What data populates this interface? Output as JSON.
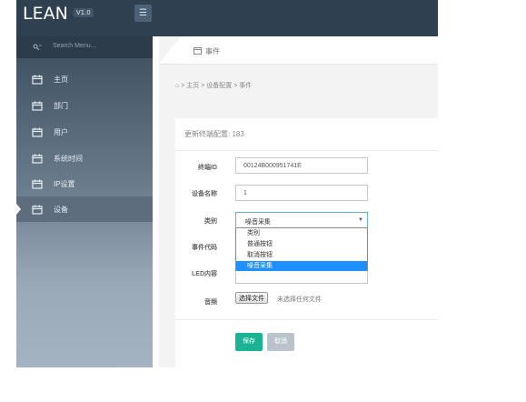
{
  "app": {
    "logo": "LEAN",
    "version": "V1.0"
  },
  "search": {
    "placeholder": "Search Menu..."
  },
  "sidebar": {
    "items": [
      {
        "label": "主页"
      },
      {
        "label": "部门"
      },
      {
        "label": "用户"
      },
      {
        "label": "系统时间"
      },
      {
        "label": "IP设置"
      },
      {
        "label": "设备"
      }
    ],
    "active_index": 5
  },
  "tab": {
    "label": "事件"
  },
  "breadcrumb": {
    "items": [
      "主页",
      "设备配置",
      "事件"
    ],
    "separator": ">"
  },
  "card": {
    "title": "更新终端配置: 183"
  },
  "form": {
    "terminal_id": {
      "label": "终端ID",
      "value": "00124B000951741E"
    },
    "device_name": {
      "label": "设备名称",
      "value": "1"
    },
    "category": {
      "label": "类别",
      "value": "噪音采集",
      "options": [
        "类别",
        "普通按钮",
        "取消按钮",
        "噪音采集"
      ],
      "selected_index": 3
    },
    "event_code": {
      "label": "事件代码"
    },
    "led_content": {
      "label": "LED内容"
    },
    "audio": {
      "label": "音频",
      "button": "选择文件",
      "hint": "未选择任何文件"
    }
  },
  "buttons": {
    "save": "保存",
    "cancel": "取消"
  },
  "colors": {
    "topbar": "#2f4050",
    "save": "#1ab394",
    "cancel": "#bac3cc",
    "selected_option": "#1e90ff"
  }
}
